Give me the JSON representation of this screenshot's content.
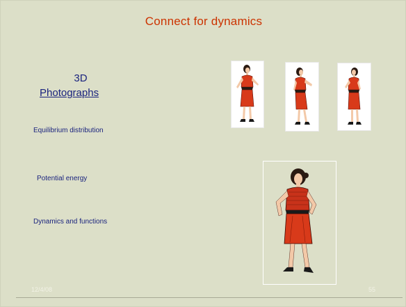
{
  "slide": {
    "title": "Connect for dynamics",
    "heading_3d": "3D",
    "heading_link": "Photographs",
    "labels": {
      "equilibrium": "Equilibrium  distribution",
      "potential": "Potential energy",
      "dynamics": "Dynamics and functions"
    },
    "footer": {
      "date": "12/4/08",
      "page_number": "55"
    }
  },
  "colors": {
    "background": "#dcdfc8",
    "title": "#cc3300",
    "text": "#1a237e",
    "dress": "#d83a1a",
    "footer_text": "#f2f2e6"
  },
  "icons": {
    "figures": [
      "dancing-woman-icon",
      "dancing-woman-icon",
      "dancing-woman-icon",
      "dancing-woman-large-icon"
    ]
  }
}
